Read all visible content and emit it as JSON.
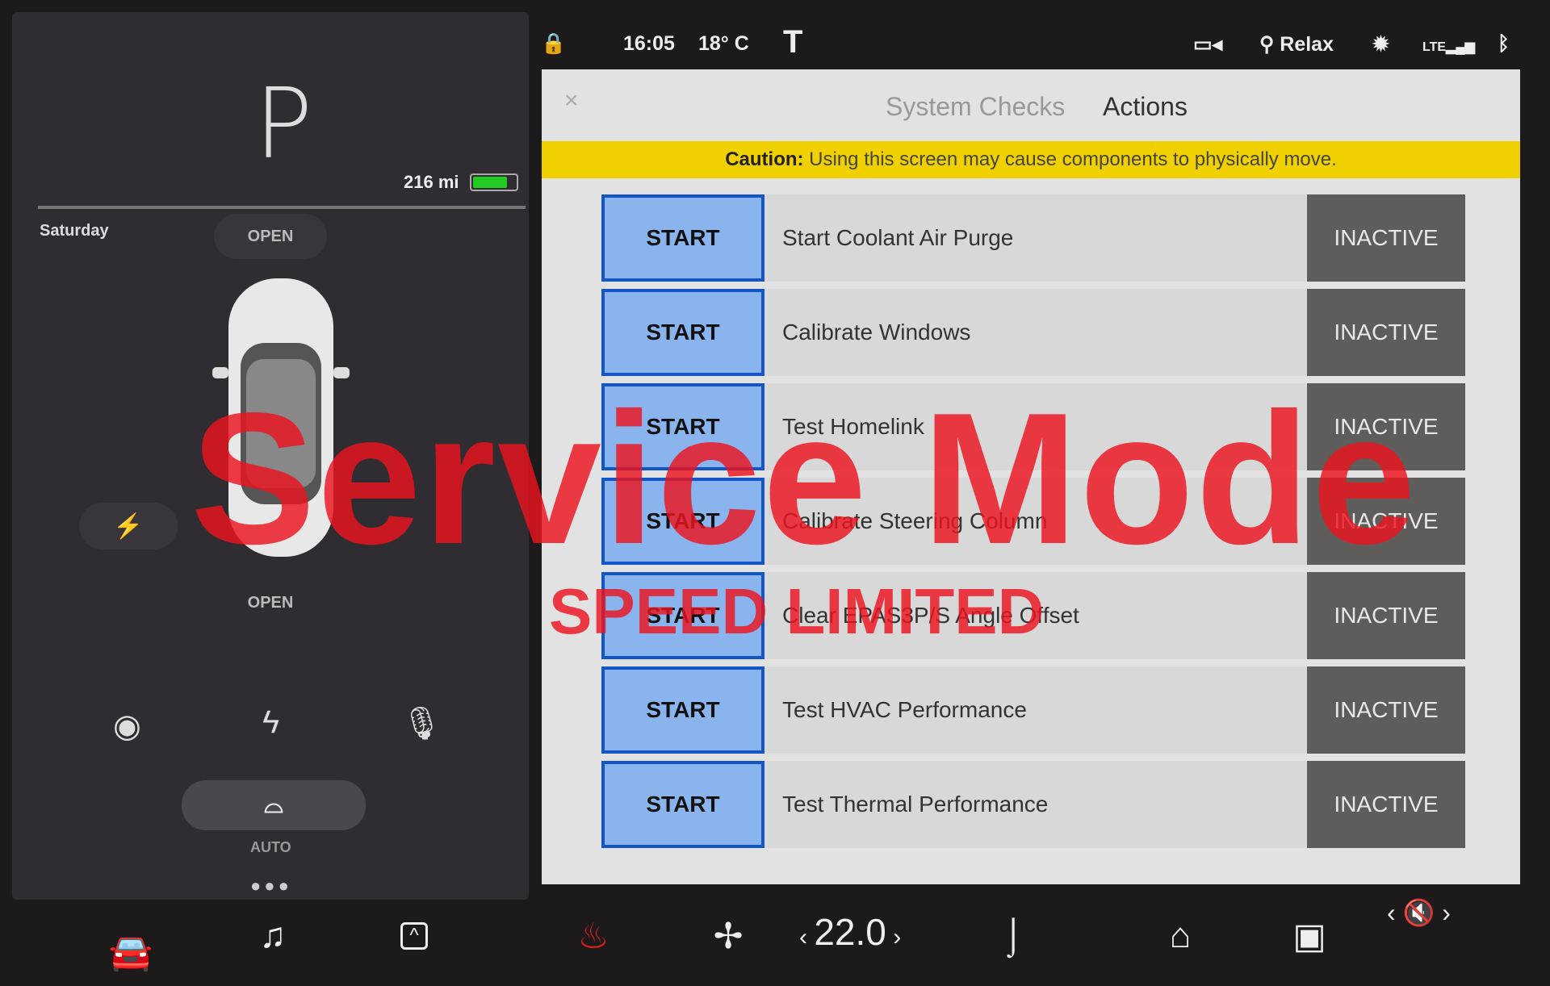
{
  "left_panel": {
    "gear": "P",
    "range": "216 mi",
    "battery_level": 0.8,
    "battery_color": "#22cc22",
    "day": "Saturday",
    "frunk_label": "OPEN",
    "trunk_label": "OPEN",
    "wiper_label": "AUTO"
  },
  "status_bar": {
    "time": "16:05",
    "temperature": "18° C",
    "profile": "Relax",
    "network": "LTE"
  },
  "modal": {
    "tabs": [
      {
        "label": "System Checks",
        "active": false
      },
      {
        "label": "Actions",
        "active": true
      }
    ],
    "caution_label": "Caution:",
    "caution_text": " Using this screen may cause components to physically move.",
    "rows": [
      {
        "button": "START",
        "label": "Start Coolant Air Purge",
        "status": "INACTIVE"
      },
      {
        "button": "START",
        "label": "Calibrate Windows",
        "status": "INACTIVE"
      },
      {
        "button": "START",
        "label": "Test Homelink",
        "status": "INACTIVE"
      },
      {
        "button": "START",
        "label": "Calibrate Steering Column",
        "status": "INACTIVE"
      },
      {
        "button": "START",
        "label": "Clear EPAS3P/S Angle Offset",
        "status": "INACTIVE"
      },
      {
        "button": "START",
        "label": "Test HVAC Performance",
        "status": "INACTIVE"
      },
      {
        "button": "START",
        "label": "Test Thermal Performance",
        "status": "INACTIVE"
      }
    ]
  },
  "watermark": {
    "title": "Service Mode",
    "subtitle": "SPEED LIMITED"
  },
  "bottom_bar": {
    "cabin_temp": "22.0",
    "accent_heat": "#e02020"
  }
}
